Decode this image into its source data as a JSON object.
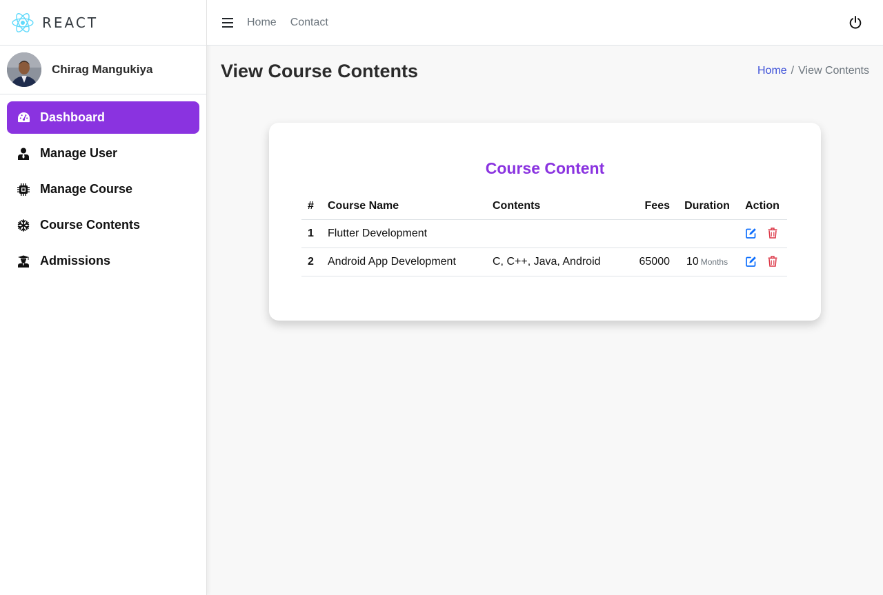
{
  "brand": {
    "name": "REACT",
    "logo_icon": "react-logo-icon",
    "color": "#61dafb"
  },
  "user": {
    "name": "Chirag Mangukiya"
  },
  "sidebar": {
    "items": [
      {
        "label": "Dashboard",
        "icon": "speedometer-icon",
        "active": true
      },
      {
        "label": "Manage User",
        "icon": "user-tie-icon",
        "active": false
      },
      {
        "label": "Manage Course",
        "icon": "microchip-icon",
        "active": false
      },
      {
        "label": "Course Contents",
        "icon": "snowflake-icon",
        "active": false
      },
      {
        "label": "Admissions",
        "icon": "graduate-icon",
        "active": false
      }
    ],
    "accent": "#8a33e0"
  },
  "topbar": {
    "links": [
      "Home",
      "Contact"
    ],
    "power_icon": "power-icon"
  },
  "page": {
    "title": "View Course Contents",
    "breadcrumb": {
      "home": "Home",
      "separator": "/",
      "current": "View Contents"
    }
  },
  "card": {
    "title": "Course Content",
    "columns": [
      "#",
      "Course Name",
      "Contents",
      "Fees",
      "Duration",
      "Action"
    ],
    "rows": [
      {
        "num": "1",
        "name": "Flutter Development",
        "contents": "",
        "fees": "",
        "duration": "",
        "unit": ""
      },
      {
        "num": "2",
        "name": "Android App Development",
        "contents": "C, C++, Java, Android",
        "fees": "65000",
        "duration": "10",
        "unit": "Months"
      }
    ],
    "edit_color": "#0d6efd",
    "delete_color": "#dc3545"
  }
}
